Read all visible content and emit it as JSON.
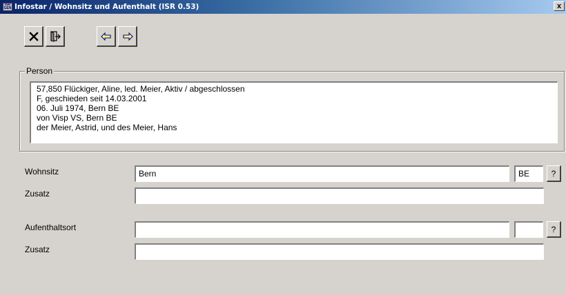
{
  "window": {
    "title": "Infostar / Wohnsitz und Aufenthalt (ISR 0.53)",
    "app_icon_text": "ISR GEN",
    "close_label": "x"
  },
  "toolbar": {
    "cancel_icon": "x-icon",
    "exit_icon": "door-exit-icon",
    "back_icon": "arrow-left-icon",
    "forward_icon": "arrow-right-icon"
  },
  "person": {
    "group_label": "Person",
    "lines": [
      "57,850  Flückiger, Aline, led. Meier, Aktiv / abgeschlossen",
      "F, geschieden seit 14.03.2001",
      "06. Juli 1974, Bern BE",
      "von Visp VS, Bern BE",
      "der Meier, Astrid, und des Meier, Hans"
    ]
  },
  "form": {
    "wohnsitz_label": "Wohnsitz",
    "wohnsitz_value": "Bern",
    "wohnsitz_canton": "BE",
    "wohnsitz_zusatz_label": "Zusatz",
    "wohnsitz_zusatz_value": "",
    "aufenthalt_label": "Aufenthaltsort",
    "aufenthalt_value": "",
    "aufenthalt_canton": "",
    "aufenthalt_zusatz_label": "Zusatz",
    "aufenthalt_zusatz_value": "",
    "help_label": "?"
  },
  "colors": {
    "face": "#d6d3ce",
    "title_start": "#0a246a",
    "title_end": "#a6caf0",
    "arrow": "#000080"
  }
}
